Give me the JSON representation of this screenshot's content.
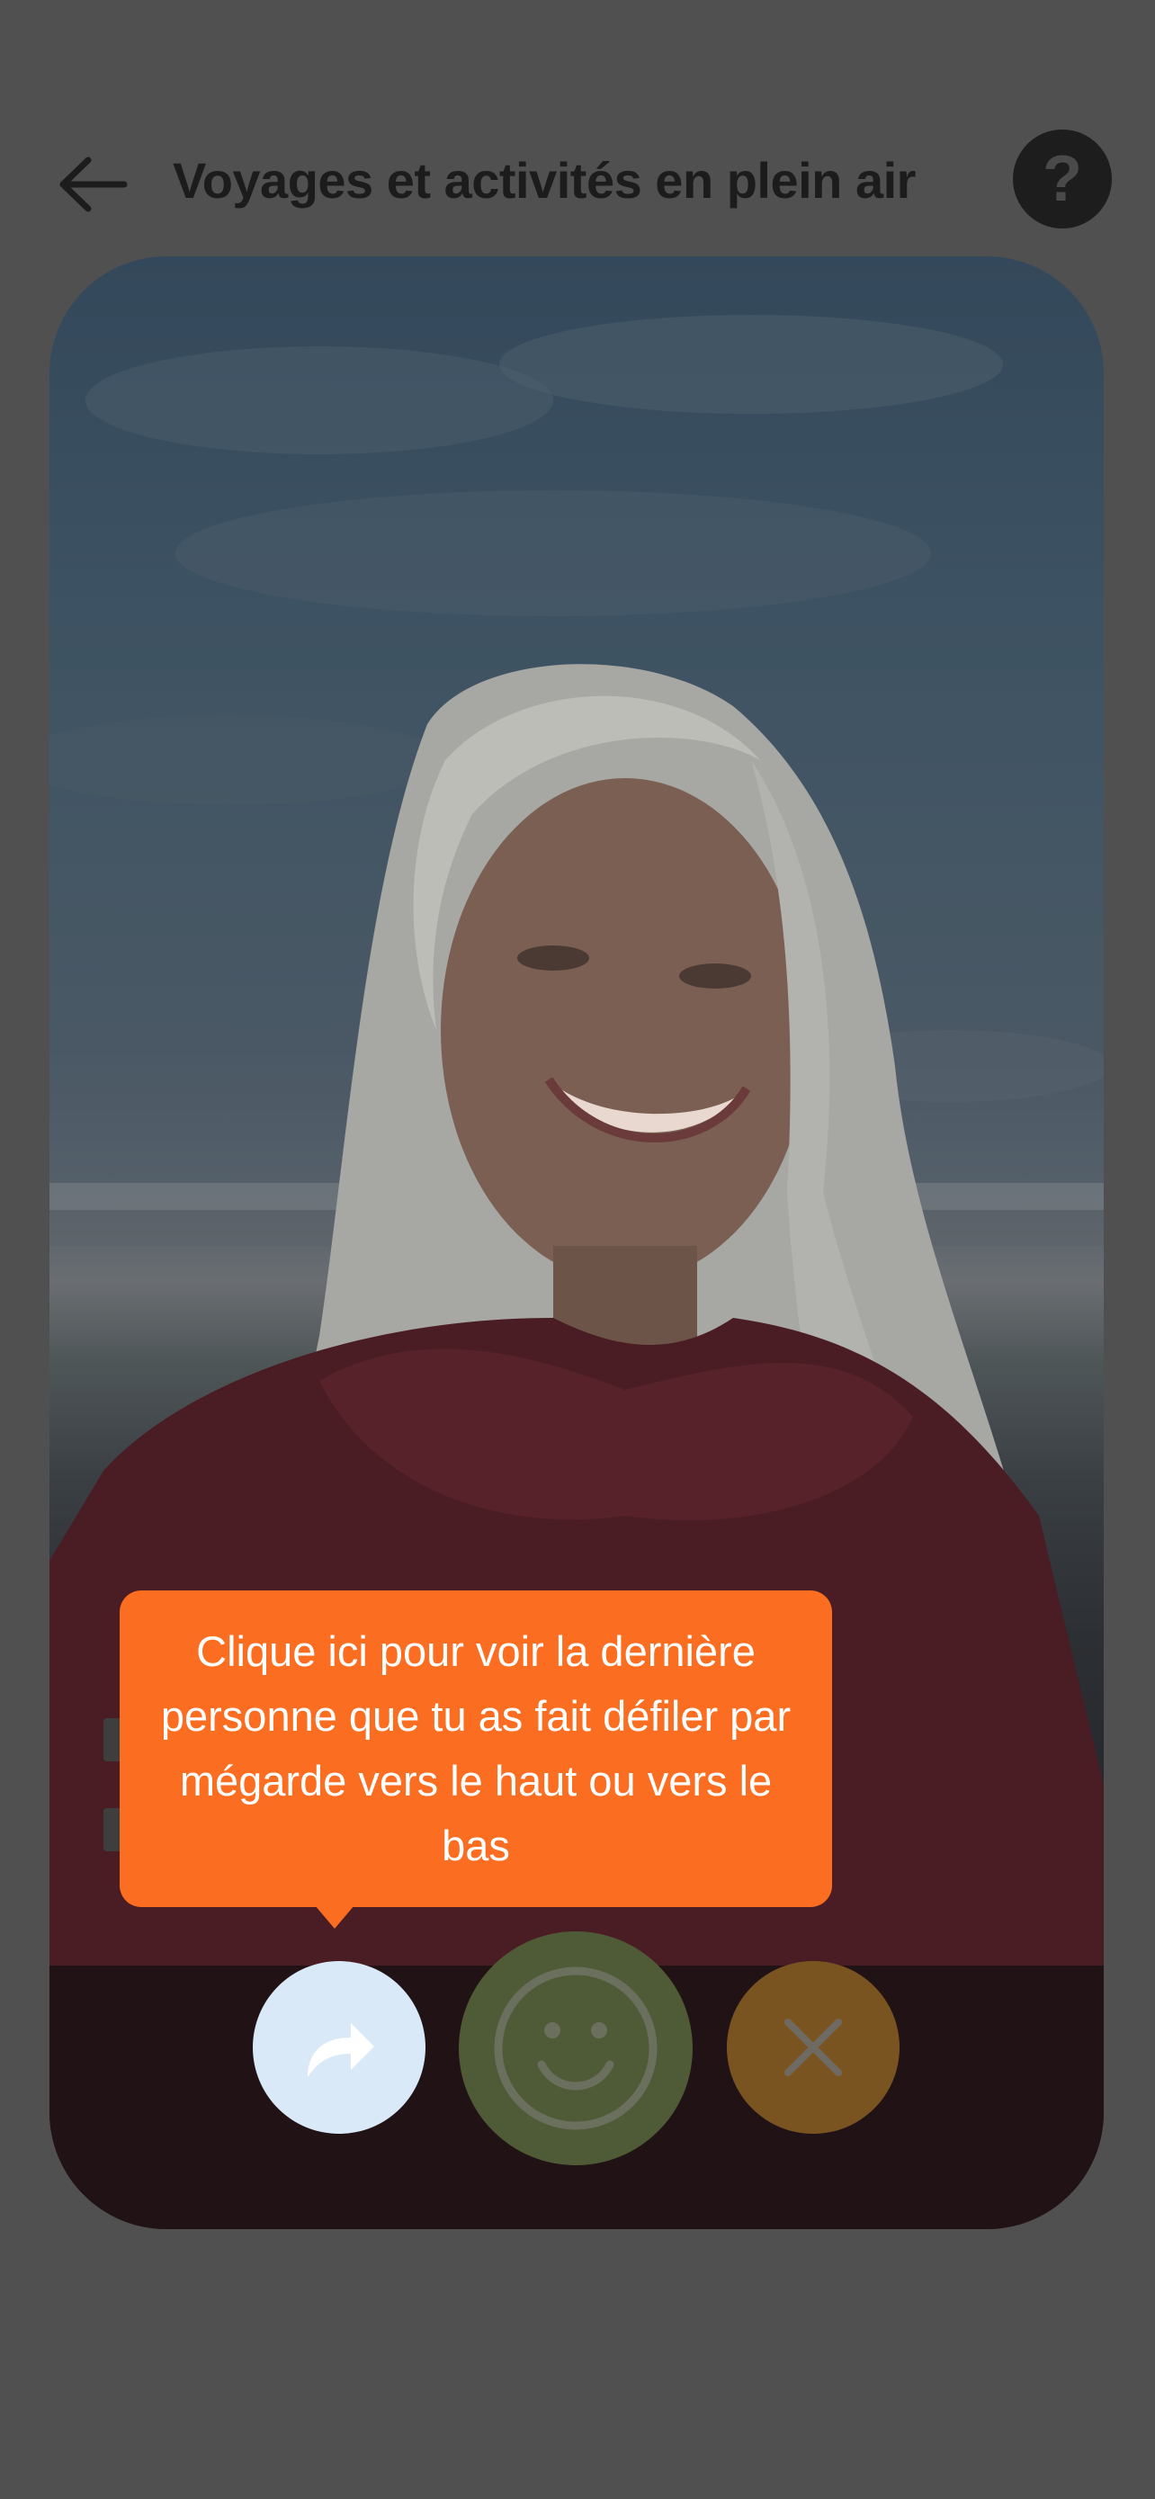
{
  "header": {
    "title": "Voyages et activités en plein air",
    "back_icon": "arrow-left-icon",
    "help_label": "?"
  },
  "profile": {
    "photo_description_icon": "profile-photo"
  },
  "tooltip": {
    "text": "Clique ici pour voir la dernière personne que tu as fait défiler par mégarde vers le haut ou vers le bas"
  },
  "actions": {
    "rewind_icon": "rewind-share-arrow-icon",
    "like_icon": "smiley-face-icon",
    "pass_icon": "close-x-icon"
  },
  "colors": {
    "overlay": "#505050",
    "tooltip": "#fb6e21",
    "rewind_button": "#d9e9f7",
    "like_button": "#4f5a36",
    "pass_button": "#7a5420"
  }
}
